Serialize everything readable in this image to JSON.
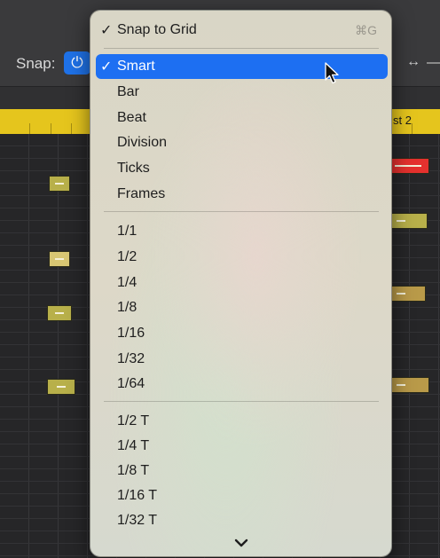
{
  "toolbar": {
    "snap_label": "Snap:",
    "power_icon": "power-icon",
    "arrow_icon": "horizontal-resize-icon"
  },
  "ruler": {
    "label": "st 2",
    "color": "#e5c51d"
  },
  "menu": {
    "snap_to_grid": {
      "label": "Snap to Grid",
      "checked": true,
      "shortcut": "⌘G"
    },
    "modes": [
      {
        "label": "Smart",
        "checked": true,
        "selected": true
      },
      {
        "label": "Bar"
      },
      {
        "label": "Beat"
      },
      {
        "label": "Division"
      },
      {
        "label": "Ticks"
      },
      {
        "label": "Frames"
      }
    ],
    "divisions": [
      {
        "label": "1/1"
      },
      {
        "label": "1/2"
      },
      {
        "label": "1/4"
      },
      {
        "label": "1/8"
      },
      {
        "label": "1/16"
      },
      {
        "label": "1/32"
      },
      {
        "label": "1/64"
      }
    ],
    "triplets": [
      {
        "label": "1/2 T"
      },
      {
        "label": "1/4 T"
      },
      {
        "label": "1/8 T"
      },
      {
        "label": "1/16 T"
      },
      {
        "label": "1/32 T"
      }
    ],
    "more_icon": "chevron-down-icon",
    "highlight_color": "#1d6ff2"
  }
}
